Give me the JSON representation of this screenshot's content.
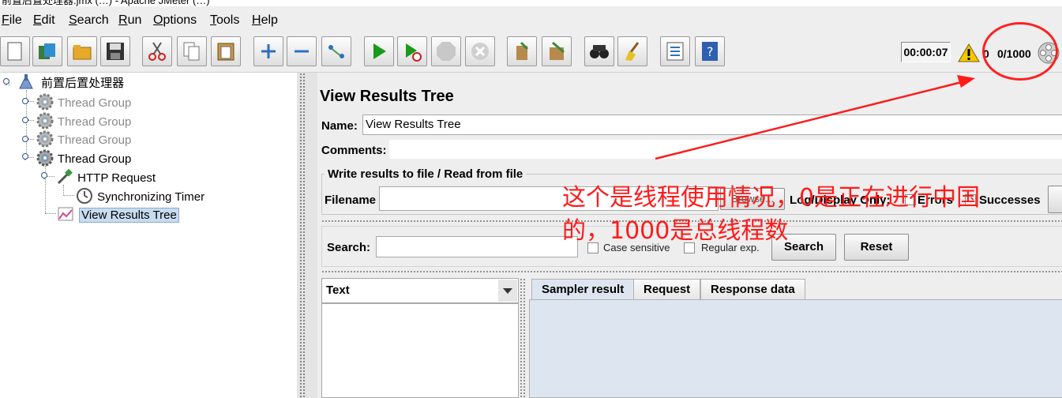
{
  "window": {
    "title_fragment": "前置后置处理器.jmx (…) - Apache JMeter (…)"
  },
  "menu": [
    {
      "label": "File",
      "mnemonic": "F",
      "rest": "ile"
    },
    {
      "label": "Edit",
      "mnemonic": "E",
      "rest": "dit"
    },
    {
      "label": "Search",
      "mnemonic": "S",
      "rest": "earch"
    },
    {
      "label": "Run",
      "mnemonic": "R",
      "rest": "un"
    },
    {
      "label": "Options",
      "mnemonic": "O",
      "rest": "ptions"
    },
    {
      "label": "Tools",
      "mnemonic": "T",
      "rest": "ools"
    },
    {
      "label": "Help",
      "mnemonic": "H",
      "rest": "elp"
    }
  ],
  "toolbar": {
    "buttons": [
      "new-icon",
      "templates-icon",
      "open-icon",
      "save-icon",
      "cut-icon",
      "copy-icon",
      "paste-icon",
      "expand-icon",
      "collapse-icon",
      "toggle-icon",
      "start-icon",
      "start-no-pauses-icon",
      "stop-icon",
      "shutdown-icon",
      "clear-icon",
      "clear-all-icon",
      "search-icon",
      "reset-search-icon",
      "function-helper-icon",
      "help-icon"
    ],
    "elapsed_time": "00:00:07",
    "error_count": "0",
    "threads": "0/1000",
    "accent_red": "#ff2020"
  },
  "tree": {
    "nodes": [
      {
        "label": "前置后置处理器",
        "icon": "test-plan-icon",
        "disabled": false
      },
      {
        "label": "Thread Group",
        "icon": "gear-icon",
        "disabled": true
      },
      {
        "label": "Thread Group",
        "icon": "gear-icon",
        "disabled": true
      },
      {
        "label": "Thread Group",
        "icon": "gear-icon",
        "disabled": true
      },
      {
        "label": "Thread Group",
        "icon": "gear-icon",
        "disabled": false
      },
      {
        "label": "HTTP Request",
        "icon": "pipette-icon",
        "disabled": false
      },
      {
        "label": "Synchronizing Timer",
        "icon": "clock-icon",
        "disabled": false
      },
      {
        "label": "View Results Tree",
        "icon": "chart-icon",
        "disabled": false,
        "selected": true
      }
    ]
  },
  "panel": {
    "title": "View Results Tree",
    "name_label": "Name:",
    "name_value": "View Results Tree",
    "comments_label": "Comments:",
    "file_section": "Write results to file / Read from file",
    "filename_label": "Filename",
    "browse_label": "Browse...",
    "log_display_label": "Log/Display Only:",
    "errors_label": "Errors",
    "successes_label": "Successes",
    "search_label": "Search:",
    "case_sensitive_label": "Case sensitive",
    "regular_exp_label": "Regular exp.",
    "search_button": "Search",
    "reset_button": "Reset",
    "renderer_value": "Text",
    "tabs": [
      "Sampler result",
      "Request",
      "Response data"
    ]
  },
  "annotation": {
    "line1": "这个是线程使用情况，0是正在进行中国",
    "line2": "的，1000是总线程数",
    "color": "#ff1a1a"
  }
}
